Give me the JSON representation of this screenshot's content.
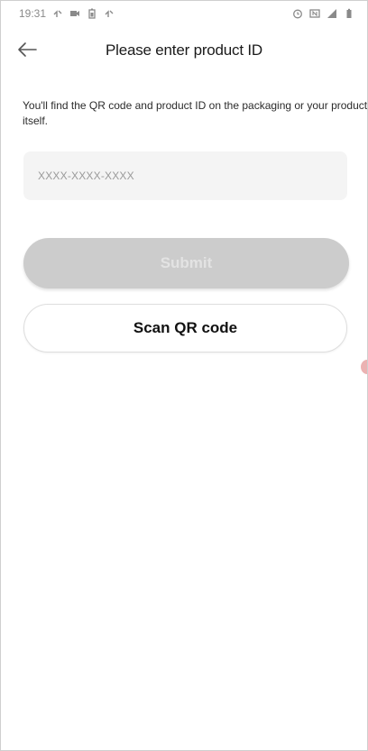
{
  "status_bar": {
    "time": "19:31",
    "left_icons": [
      "wifi-call-icon",
      "camera-icon",
      "battery-saver-icon",
      "wifi-call-icon"
    ],
    "right_icons": [
      "alarm-icon",
      "nfc-icon",
      "signal-icon",
      "battery-icon"
    ]
  },
  "header": {
    "title": "Please enter product ID",
    "back_icon": "arrow-left-icon"
  },
  "main": {
    "help_text": "You'll find the QR code and product ID on the packaging or your product itself.",
    "product_id_input": {
      "placeholder": "XXXX-XXXX-XXXX",
      "value": ""
    },
    "submit_label": "Submit",
    "scan_label": "Scan QR code"
  },
  "colors": {
    "submit_disabled_bg": "#cccccc",
    "input_bg": "#f4f4f4",
    "edge_indicator": "#e8a4a4"
  }
}
